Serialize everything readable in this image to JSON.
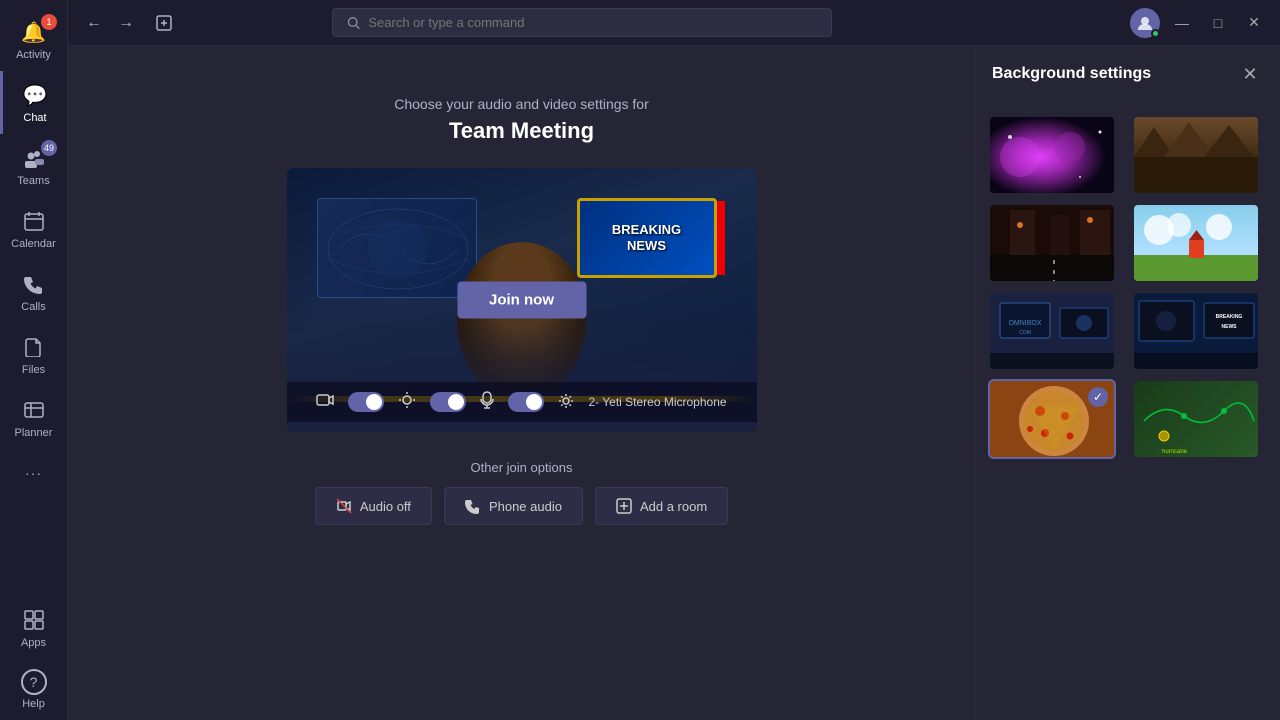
{
  "titlebar": {
    "search_placeholder": "Search or type a command",
    "back_label": "←",
    "forward_label": "→",
    "compose_label": "✎",
    "minimize_label": "—",
    "maximize_label": "□",
    "close_label": "✕"
  },
  "sidebar": {
    "items": [
      {
        "id": "activity",
        "label": "Activity",
        "icon": "🔔",
        "badge": "1"
      },
      {
        "id": "chat",
        "label": "Chat",
        "icon": "💬",
        "active": true
      },
      {
        "id": "teams",
        "label": "Teams",
        "icon": "👥",
        "badge_teams": "49"
      },
      {
        "id": "calendar",
        "label": "Calendar",
        "icon": "📅"
      },
      {
        "id": "calls",
        "label": "Calls",
        "icon": "📞"
      },
      {
        "id": "files",
        "label": "Files",
        "icon": "📁"
      },
      {
        "id": "planner",
        "label": "Planner",
        "icon": "📋"
      },
      {
        "id": "more",
        "label": "...",
        "icon": "···"
      }
    ],
    "bottom_items": [
      {
        "id": "apps",
        "label": "Apps",
        "icon": "⊞"
      },
      {
        "id": "help",
        "label": "Help",
        "icon": "?"
      }
    ]
  },
  "prejoin": {
    "subtitle": "Choose your audio and video settings for",
    "meeting_title": "Team Meeting",
    "join_button_label": "Join now"
  },
  "controls": {
    "device_label": "2- Yeti Stereo Microphone"
  },
  "other_join": {
    "title": "Other join options",
    "audio_off": "Audio off",
    "phone_audio": "Phone audio",
    "add_room": "Add a room"
  },
  "bg_panel": {
    "title": "Background settings",
    "close_label": "✕",
    "backgrounds": [
      {
        "id": "galaxy",
        "type": "galaxy",
        "selected": false
      },
      {
        "id": "forest",
        "type": "forest",
        "selected": false
      },
      {
        "id": "street",
        "type": "street",
        "selected": false
      },
      {
        "id": "cartoon",
        "type": "cartoon",
        "selected": false
      },
      {
        "id": "studio1",
        "type": "studio1",
        "selected": false
      },
      {
        "id": "studio2",
        "type": "studio2",
        "selected": false
      },
      {
        "id": "pizza",
        "type": "pizza",
        "selected": true
      },
      {
        "id": "map",
        "type": "map",
        "selected": false
      }
    ]
  }
}
